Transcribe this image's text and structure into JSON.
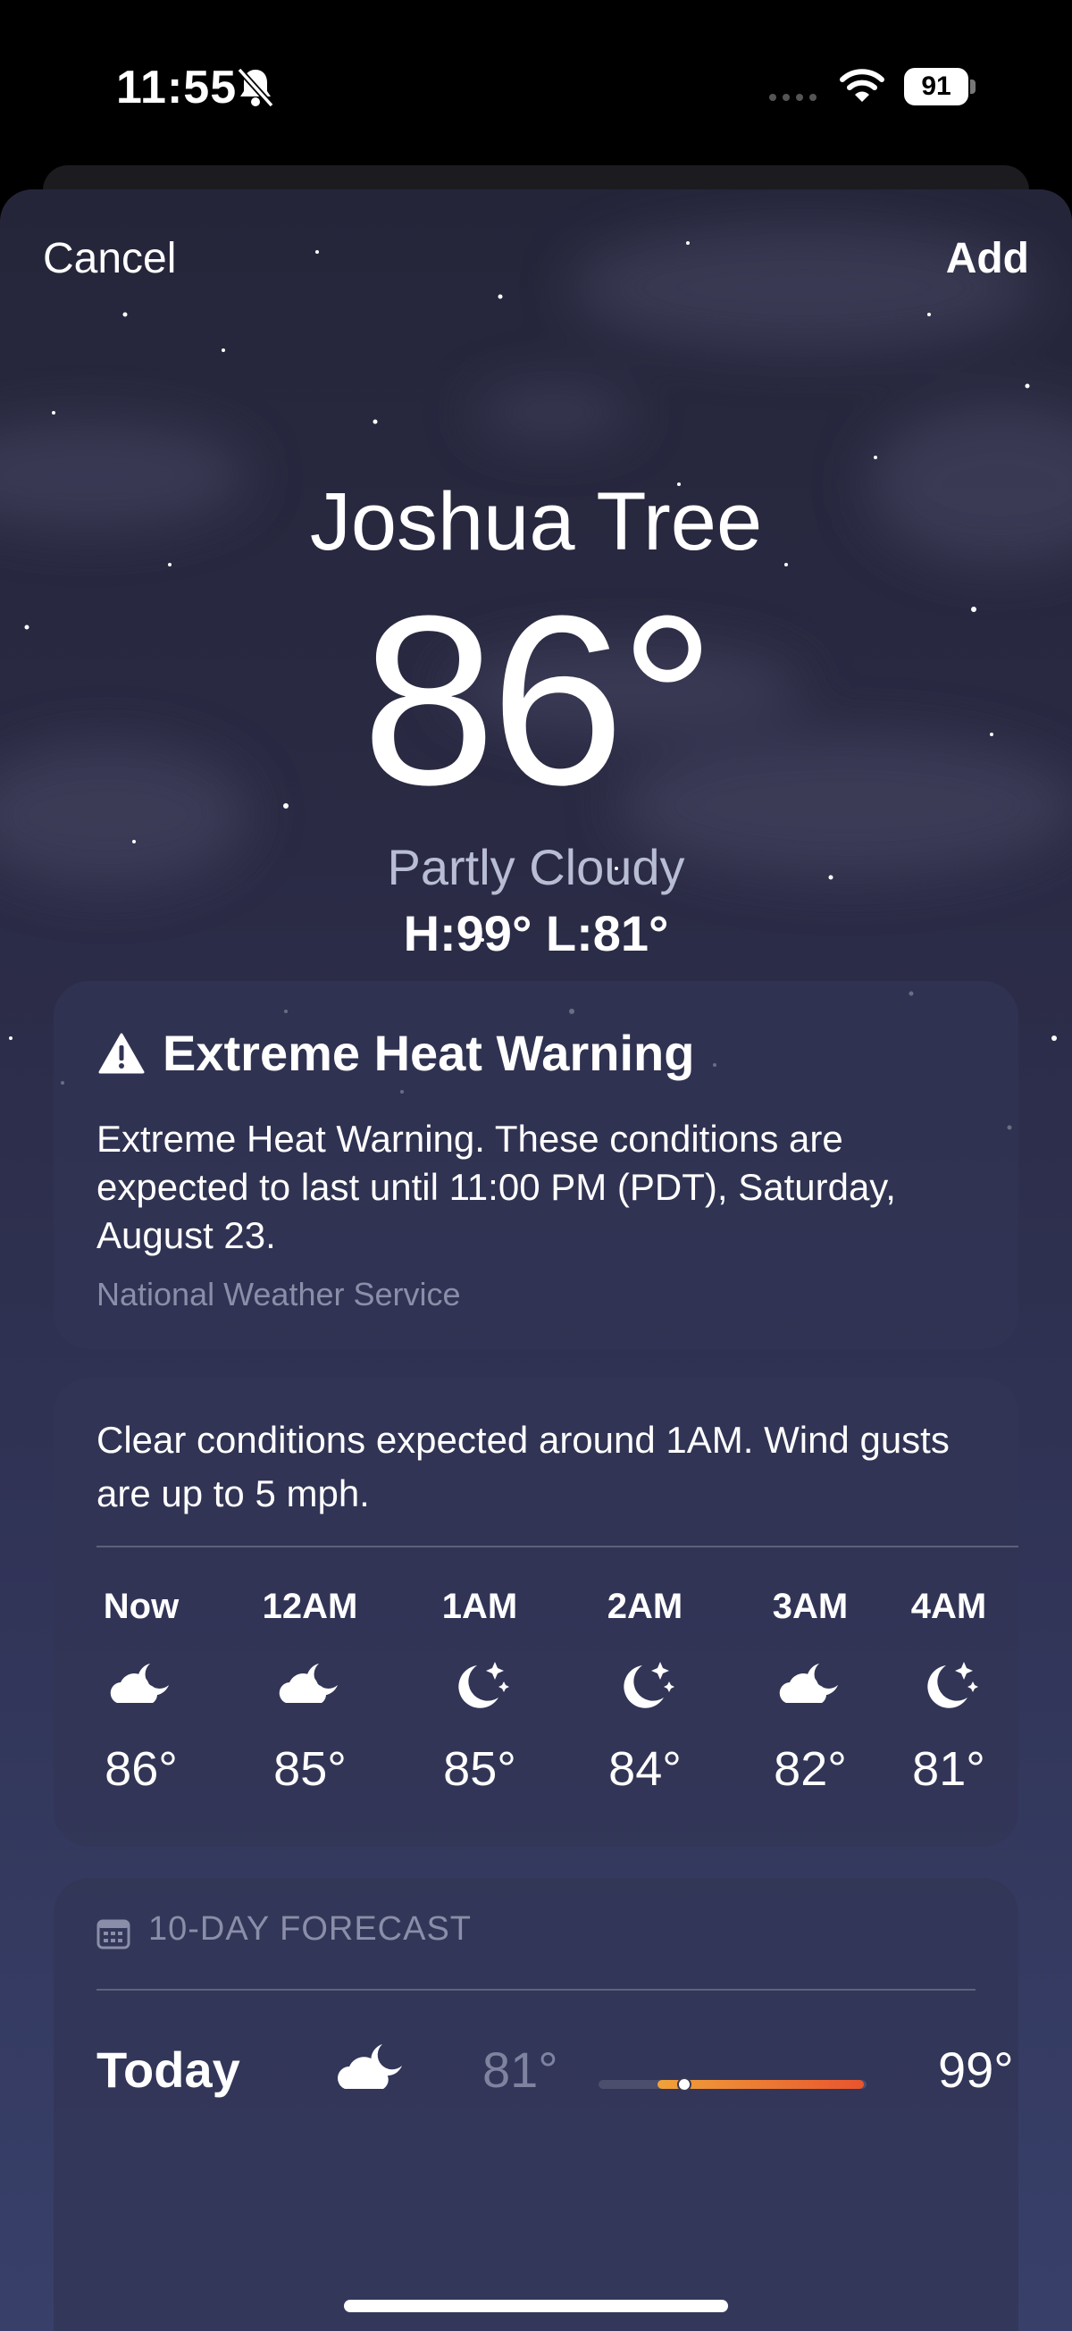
{
  "status_bar": {
    "time": "11:55",
    "battery": "91"
  },
  "nav": {
    "cancel": "Cancel",
    "add": "Add"
  },
  "weather": {
    "city": "Joshua Tree",
    "temperature": "86°",
    "condition": "Partly Cloudy",
    "high_low": "H:99°  L:81°"
  },
  "alert": {
    "title": "Extreme Heat Warning",
    "text": "Extreme Heat Warning. These conditions are expected to last until 11:00 PM (PDT), Saturday, August 23.",
    "source": "National Weather Service"
  },
  "hourly": {
    "summary": "Clear conditions expected around 1AM. Wind gusts are up to 5 mph.",
    "hours": [
      {
        "label": "Now",
        "icon": "partly-cloudy-night-icon",
        "temp": "86°"
      },
      {
        "label": "12AM",
        "icon": "partly-cloudy-night-icon",
        "temp": "85°"
      },
      {
        "label": "1AM",
        "icon": "moon-stars-icon",
        "temp": "85°"
      },
      {
        "label": "2AM",
        "icon": "moon-stars-icon",
        "temp": "84°"
      },
      {
        "label": "3AM",
        "icon": "partly-cloudy-night-icon",
        "temp": "82°"
      },
      {
        "label": "4AM",
        "icon": "moon-stars-icon",
        "temp": "81°"
      }
    ]
  },
  "forecast": {
    "header": "10-DAY FORECAST",
    "days": [
      {
        "day": "Today",
        "icon": "partly-cloudy-night-icon",
        "low": "81°",
        "high": "99°",
        "range_start": 0.22,
        "range_end": 0.99,
        "current": 0.32
      }
    ]
  },
  "colors": {
    "sky_top": "#25253a",
    "sky_bottom": "#38406a",
    "card": "#323455",
    "range_warm": "#f0a23a",
    "range_hot": "#e8542e"
  }
}
